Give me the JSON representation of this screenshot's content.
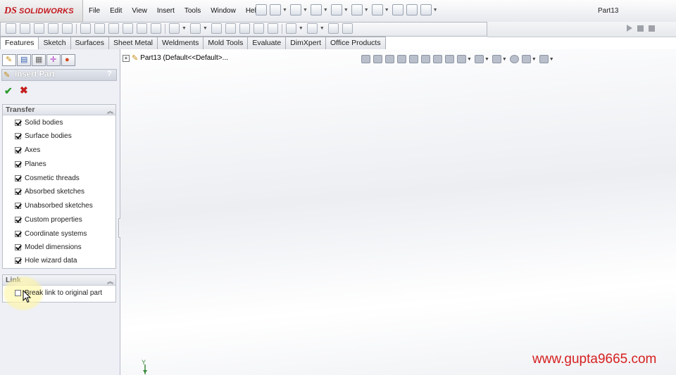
{
  "app": {
    "brand": "SOLIDWORKS",
    "brand_mark": "DS",
    "document_title": "Part13"
  },
  "menus": [
    "File",
    "Edit",
    "View",
    "Insert",
    "Tools",
    "Window",
    "Help"
  ],
  "tabs": [
    {
      "label": "Features",
      "active": true
    },
    {
      "label": "Sketch"
    },
    {
      "label": "Surfaces"
    },
    {
      "label": "Sheet Metal"
    },
    {
      "label": "Weldments"
    },
    {
      "label": "Mold Tools"
    },
    {
      "label": "Evaluate"
    },
    {
      "label": "DimXpert"
    },
    {
      "label": "Office Products"
    }
  ],
  "property_manager": {
    "title": "Insert Part",
    "help": "?",
    "ok_glyph": "✔",
    "cancel_glyph": "✖",
    "transfer": {
      "title": "Transfer",
      "items": [
        {
          "label": "Solid bodies",
          "checked": true
        },
        {
          "label": "Surface bodies",
          "checked": true
        },
        {
          "label": "Axes",
          "checked": true
        },
        {
          "label": "Planes",
          "checked": true
        },
        {
          "label": "Cosmetic threads",
          "checked": true
        },
        {
          "label": "Absorbed sketches",
          "checked": true
        },
        {
          "label": "Unabsorbed sketches",
          "checked": true
        },
        {
          "label": "Custom properties",
          "checked": true
        },
        {
          "label": "Coordinate systems",
          "checked": true
        },
        {
          "label": "Model dimensions",
          "checked": true
        },
        {
          "label": "Hole wizard data",
          "checked": true
        }
      ]
    },
    "link": {
      "title": "Link",
      "items": [
        {
          "label": "Break link to original part",
          "checked": false
        }
      ]
    }
  },
  "feature_tree": {
    "root": "Part13  (Default<<Default>..."
  },
  "triad_label": "Y",
  "watermark": "www.gupta9665.com",
  "colors": {
    "brand_red": "#c4161c",
    "watermark_red": "#d62020",
    "ok_green": "#2e9b2e",
    "cancel_red": "#c51f1f"
  }
}
